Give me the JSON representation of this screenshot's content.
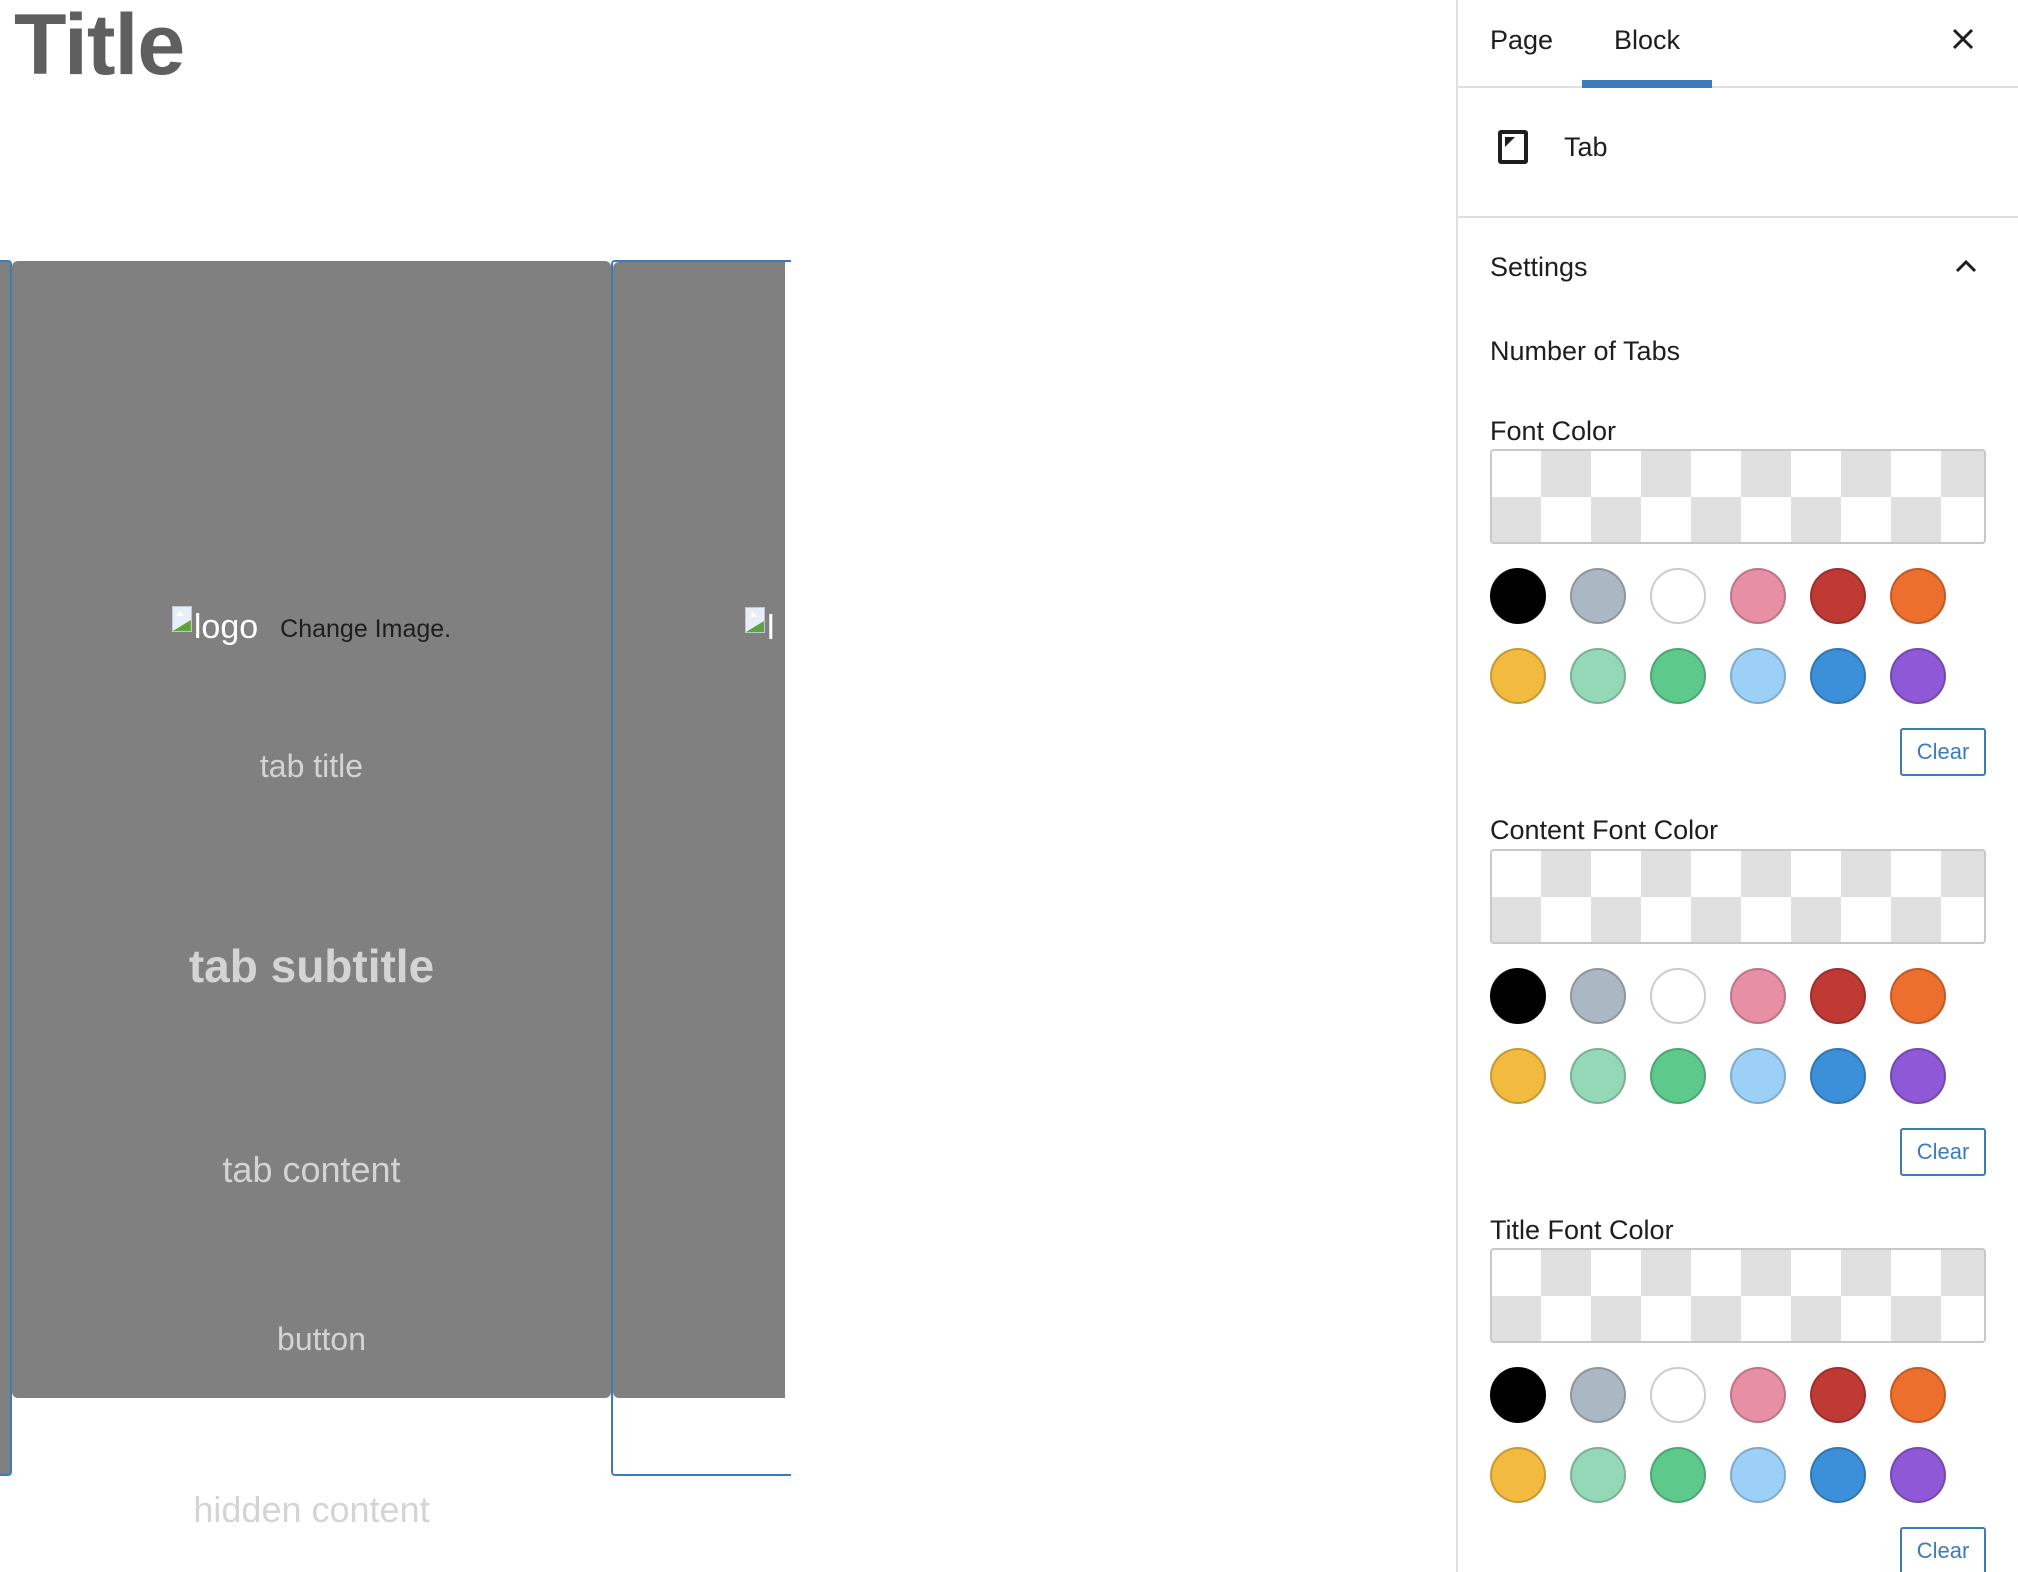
{
  "editor": {
    "page_title": "Title",
    "tab_card": {
      "logo_alt": "logo",
      "change_image_label": "Change Image.",
      "tab_title": "tab title",
      "tab_subtitle": "tab subtitle",
      "tab_content": "tab content",
      "button_label": "button",
      "hidden_content": "hidden content"
    },
    "tab_card_2": {
      "logo_alt": "l"
    }
  },
  "sidebar": {
    "tabs": [
      {
        "label": "Page",
        "active": false
      },
      {
        "label": "Block",
        "active": true
      }
    ],
    "close_icon": "close-icon",
    "block": {
      "icon": "tab-block-icon",
      "name": "Tab"
    },
    "settings": {
      "title": "Settings",
      "expanded": true,
      "number_of_tabs_label": "Number of Tabs",
      "color_fields": [
        {
          "label": "Font Color",
          "clear_label": "Clear",
          "value": null
        },
        {
          "label": "Content Font Color",
          "clear_label": "Clear",
          "value": null
        },
        {
          "label": "Title Font Color",
          "clear_label": "Clear",
          "value": null
        }
      ],
      "palette": [
        {
          "name": "black",
          "hex": "#000000"
        },
        {
          "name": "cyan-bluish-gray",
          "hex": "#abb8c3"
        },
        {
          "name": "white",
          "hex": "#ffffff"
        },
        {
          "name": "pale-pink",
          "hex": "#e78fa4"
        },
        {
          "name": "vivid-red",
          "hex": "#bf3a35"
        },
        {
          "name": "luminous-vivid-orange",
          "hex": "#ec6f2e"
        },
        {
          "name": "luminous-vivid-amber",
          "hex": "#f2bb40"
        },
        {
          "name": "light-green-cyan",
          "hex": "#95d8b7"
        },
        {
          "name": "vivid-green-cyan",
          "hex": "#5dca8c"
        },
        {
          "name": "pale-cyan-blue",
          "hex": "#9cd0f6"
        },
        {
          "name": "vivid-cyan-blue",
          "hex": "#3c90d9"
        },
        {
          "name": "vivid-purple",
          "hex": "#8e58d6"
        }
      ]
    }
  },
  "colors": {
    "accent": "#3b7dbb",
    "card_bg": "#808080",
    "title_text": "#5f5f5f"
  }
}
